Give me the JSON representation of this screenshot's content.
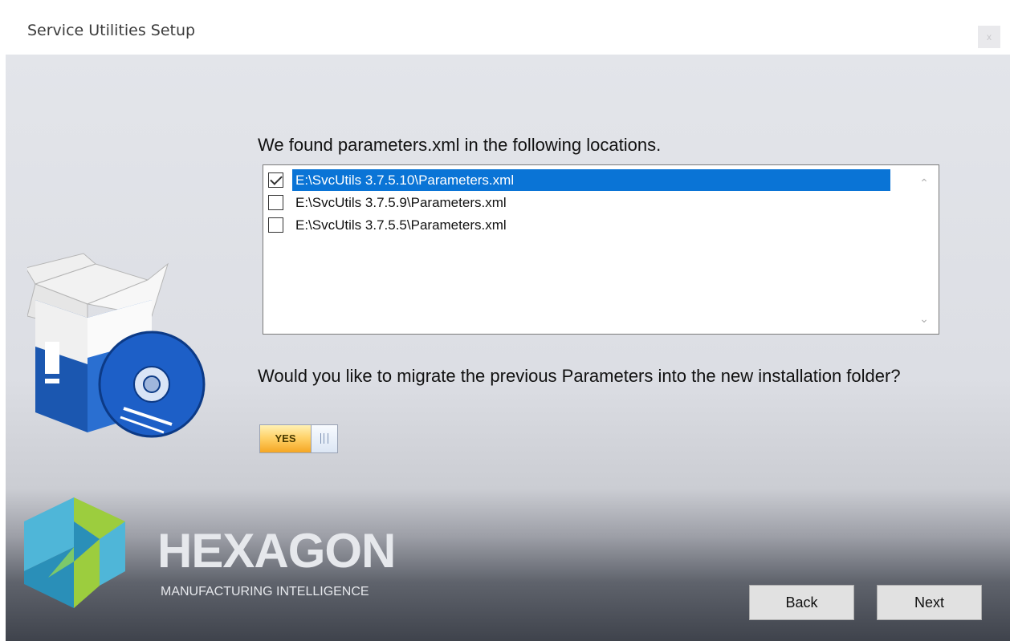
{
  "window": {
    "title": "Service Utilities Setup",
    "close_label": "x"
  },
  "content": {
    "heading": "We found parameters.xml in the following locations.",
    "locations": [
      {
        "path": "E:\\SvcUtils 3.7.5.10\\Parameters.xml",
        "checked": true,
        "selected": true
      },
      {
        "path": "E:\\SvcUtils 3.7.5.9\\Parameters.xml",
        "checked": false,
        "selected": false
      },
      {
        "path": "E:\\SvcUtils 3.7.5.5\\Parameters.xml",
        "checked": false,
        "selected": false
      }
    ],
    "question": "Would you like to migrate the previous Parameters into the new installation folder?",
    "toggle": {
      "label": "YES",
      "state": "on"
    }
  },
  "branding": {
    "name": "HEXAGON",
    "tagline": "MANUFACTURING INTELLIGENCE"
  },
  "buttons": {
    "back": "Back",
    "next": "Next"
  },
  "icons": {
    "setup": "software-box-icon",
    "logo": "hexagon-logo-icon",
    "scroll_up": "chevron-up-icon",
    "scroll_down": "chevron-down-icon"
  },
  "colors": {
    "selection": "#0a74d6",
    "toggle_on": "#ffd36a",
    "brand_text": "#e6e8ec"
  }
}
